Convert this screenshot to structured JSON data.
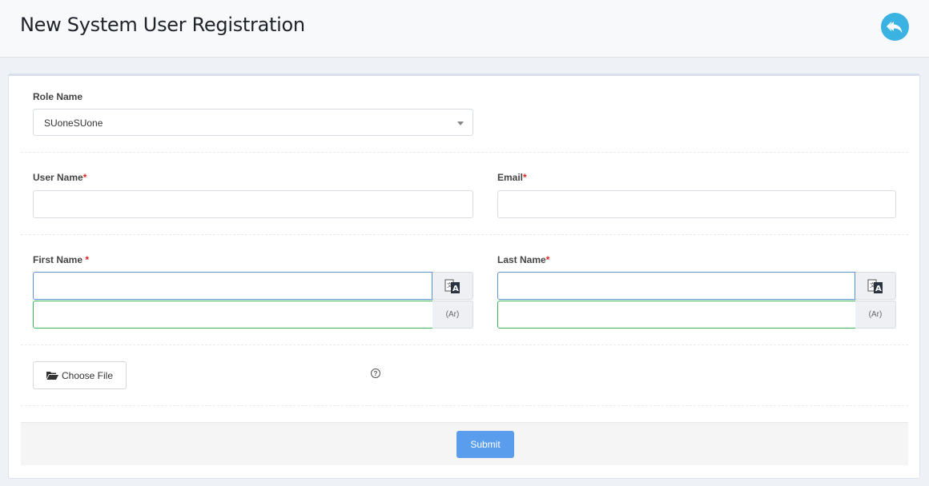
{
  "header": {
    "title": "New System User Registration",
    "back_icon": "reply-all-icon",
    "back_color": "#3ab3e3"
  },
  "form": {
    "role": {
      "label": "Role Name",
      "value": "SUoneSUone"
    },
    "username": {
      "label": "User Name",
      "required_mark": "*",
      "value": ""
    },
    "email": {
      "label": "Email",
      "required_mark": "*",
      "value": ""
    },
    "first_name": {
      "label": "First Name ",
      "required_mark": "*",
      "value_en": "",
      "value_ar": "",
      "translate_icon": "translate-icon",
      "ar_addon": "(Ar)"
    },
    "last_name": {
      "label": "Last Name",
      "required_mark": "*",
      "value_en": "",
      "value_ar": "",
      "translate_icon": "translate-icon",
      "ar_addon": "(Ar)"
    },
    "file": {
      "button_label": "Choose File",
      "icon": "folder-open-icon",
      "help_icon": "question-circle-icon",
      "help_glyph": "?"
    }
  },
  "footer": {
    "submit_label": "Submit",
    "submit_color": "#5b9ded"
  }
}
